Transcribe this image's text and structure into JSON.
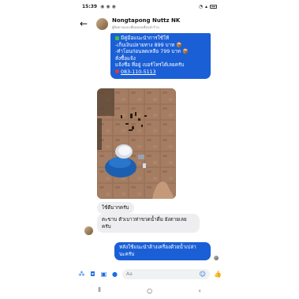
{
  "status_bar": {
    "time": "15:39"
  },
  "header": {
    "contact_name": "Nongtapong Nuttz NK",
    "subtitle": "ผู้ติดตามและเพื่อนของเพื่อนนำร้าน"
  },
  "messages": {
    "promo": {
      "lines": [
        "มีคู่มือแนะนำการใช้ให้",
        "-เก็บเงินปลายทาง 899 บาท",
        "-ทำโอนก่อนลดเหลือ 799 บาท",
        "สั่งซื้อแจ้ง",
        "แจ้งชื่อ ที่อยู่ เบอร์โทรได้เลยครับ"
      ],
      "phone": "083-110-5113"
    },
    "received_1": "ใช้ดีมากครับ",
    "received_2": [
      "ตะขาบ ตัวเบาวท่าขวดน้ำดื่ม ยังตายเลย",
      "ครับ"
    ],
    "sent_reply": [
      "หลังใช้แนะนำล้างเครื่องด้วยน้ำเปล่า",
      "นะครับ"
    ]
  },
  "composer": {
    "placeholder": "Aa"
  },
  "colors": {
    "messenger_blue": "#1a5fd6",
    "bubble_gray": "#eeeef0"
  }
}
